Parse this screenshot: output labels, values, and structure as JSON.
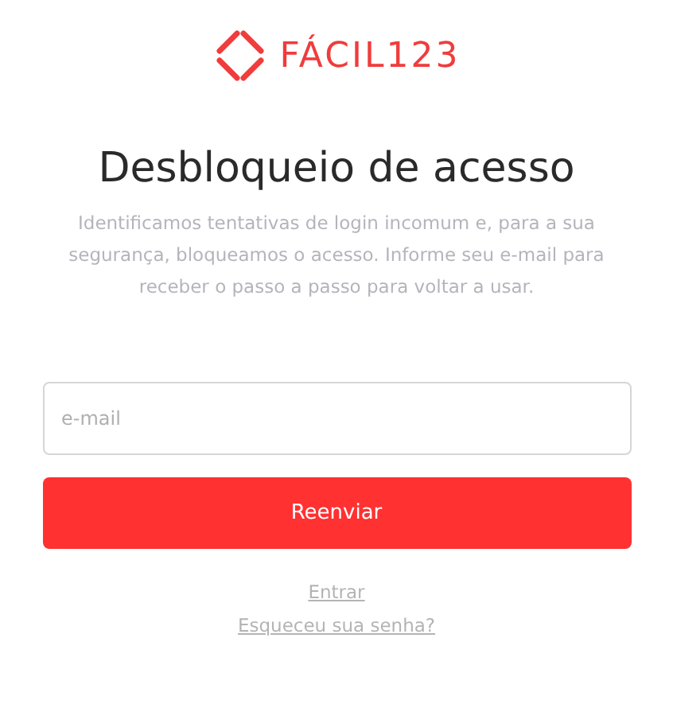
{
  "logo": {
    "text": "FÁCIL123"
  },
  "title": "Desbloqueio de acesso",
  "description": "Identificamos tentativas de login incomum e, para a sua segurança, bloqueamos o acesso. Informe seu e-mail para receber o passo a passo para voltar a usar.",
  "email_field": {
    "placeholder": "e-mail"
  },
  "submit_button": "Reenviar",
  "links": [
    "Entrar",
    "Esqueceu sua senha?"
  ]
}
